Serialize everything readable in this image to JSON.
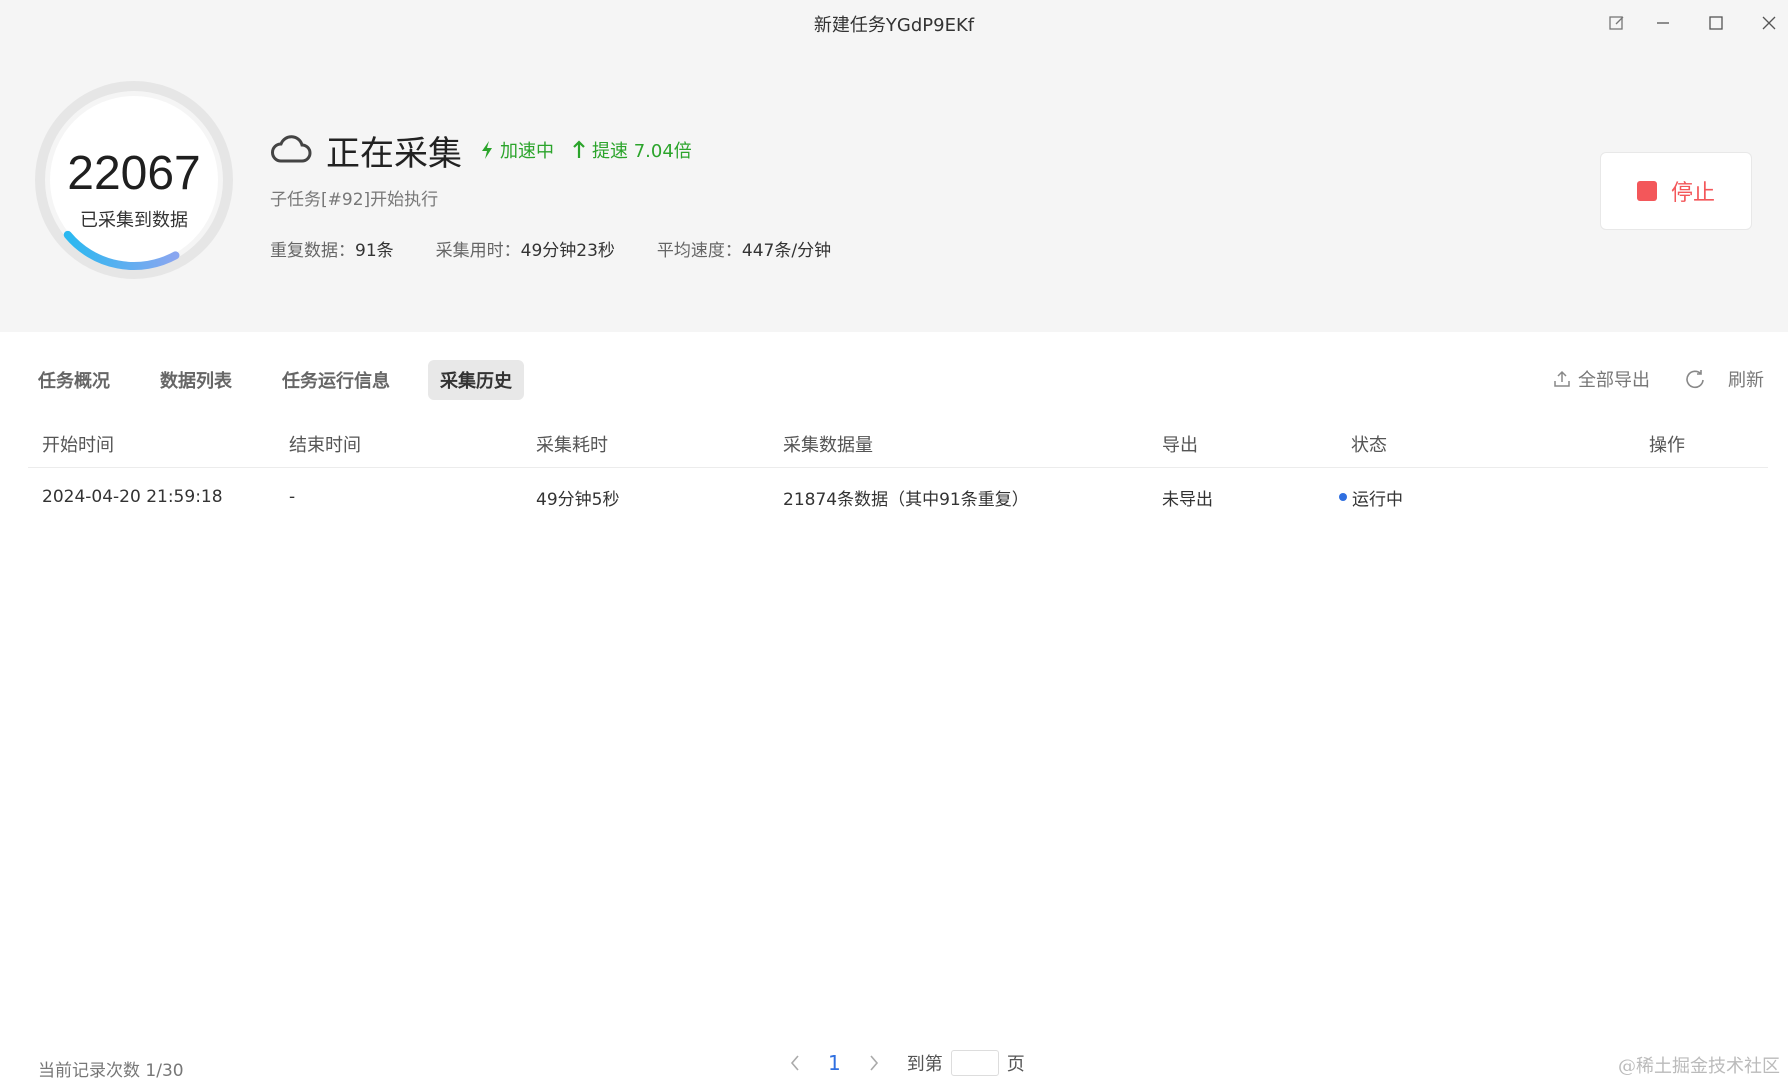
{
  "window": {
    "title": "新建任务YGdP9EKf",
    "buttons": [
      "edit-icon",
      "minimize-icon",
      "maximize-icon",
      "close-icon"
    ]
  },
  "summary": {
    "collected_count": "22067",
    "collected_label": "已采集到数据",
    "progress_fraction": 0.22,
    "status": "正在采集",
    "accelerating": "加速中",
    "speedup": "提速 7.04倍",
    "subtask": "子任务[#92]开始执行",
    "stats": [
      {
        "key": "重复数据：",
        "value": "91条"
      },
      {
        "key": "采集用时：",
        "value": "49分钟23秒"
      },
      {
        "key": "平均速度：",
        "value": "447条/分钟"
      }
    ],
    "stop_label": "停止",
    "accent_green": "#2ba42b",
    "stop_red": "#f3575a"
  },
  "tabs": [
    {
      "label": "任务概况",
      "active": false
    },
    {
      "label": "数据列表",
      "active": false
    },
    {
      "label": "任务运行信息",
      "active": false
    },
    {
      "label": "采集历史",
      "active": true
    }
  ],
  "tools": {
    "export_all": "全部导出",
    "refresh": "刷新"
  },
  "table": {
    "headers": [
      "开始时间",
      "结束时间",
      "采集耗时",
      "采集数据量",
      "导出",
      "状态",
      "操作"
    ],
    "rows": [
      {
        "start": "2024-04-20 21:59:18",
        "end": "-",
        "duration": "49分钟5秒",
        "amount": "21874条数据（其中91条重复）",
        "export": "未导出",
        "status": "运行中",
        "action": ""
      }
    ],
    "status_color": "#2f6fe0"
  },
  "footer": {
    "record_count": "当前记录次数 1/30",
    "current_page": "1",
    "goto_prefix": "到第",
    "goto_suffix": "页",
    "watermark": "@稀土掘金技术社区"
  }
}
